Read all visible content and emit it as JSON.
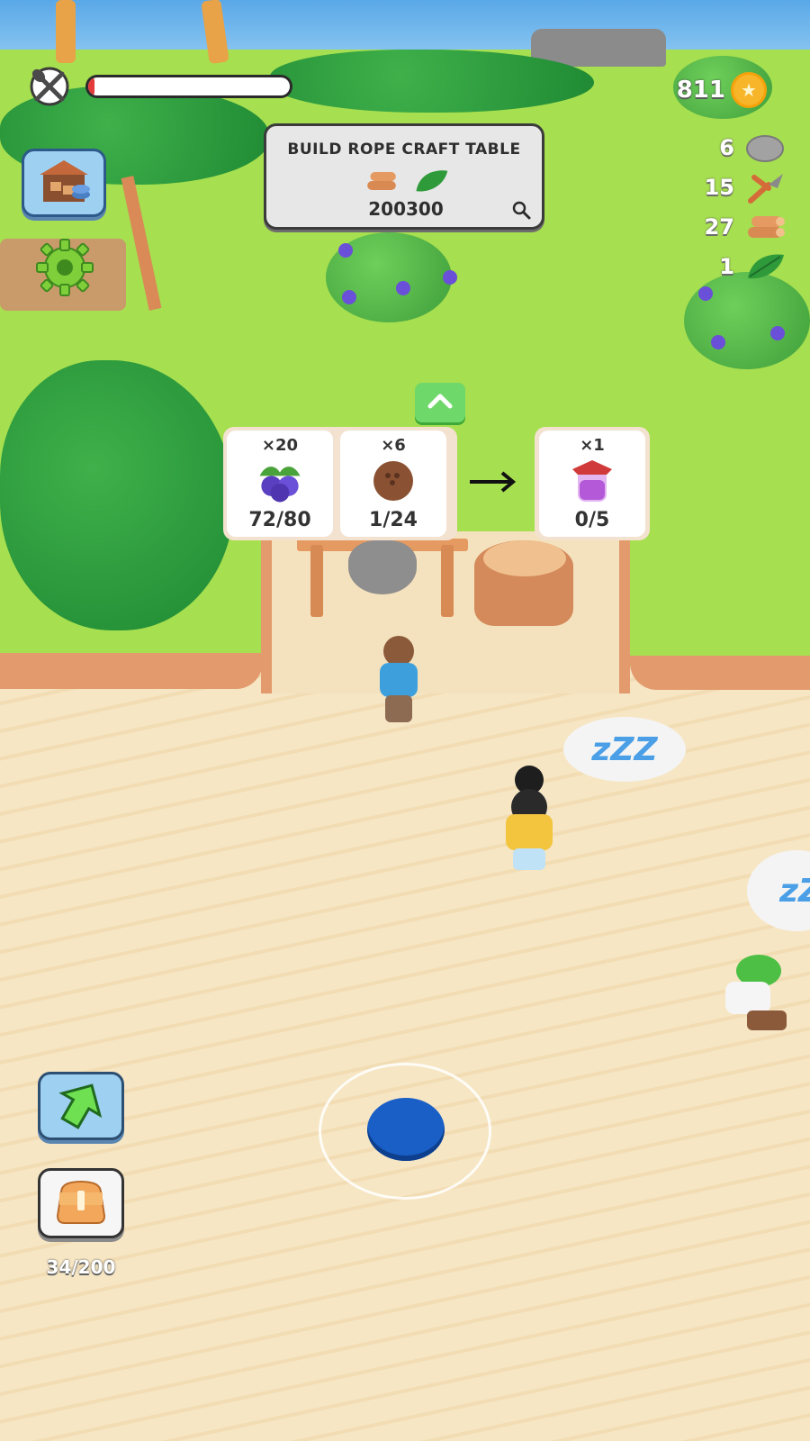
{
  "hud": {
    "hunger_level": 0.03,
    "coins": "811",
    "resources": [
      {
        "value": "6",
        "icon": "stone-icon"
      },
      {
        "value": "15",
        "icon": "pruning-shears-icon"
      },
      {
        "value": "27",
        "icon": "wood-logs-icon"
      },
      {
        "value": "1",
        "icon": "leaf-icon"
      }
    ]
  },
  "quest": {
    "title": "BUILD ROPE CRAFT TABLE",
    "costs": [
      {
        "icon": "wood-logs-icon",
        "value": "200"
      },
      {
        "icon": "leaf-icon",
        "value": "300"
      }
    ]
  },
  "recipe": {
    "inputs": [
      {
        "multiplier": "×20",
        "icon": "blueberry-icon",
        "count": "72/80"
      },
      {
        "multiplier": "×6",
        "icon": "coconut-icon",
        "count": "1/24"
      }
    ],
    "output": {
      "multiplier": "×1",
      "icon": "jam-jar-icon",
      "count": "0/5"
    }
  },
  "sleep_bubbles": [
    "zZZ",
    "zZ"
  ],
  "inventory": {
    "capacity": "34/200"
  },
  "colors": {
    "grass": "#a6df4f",
    "sand": "#f6e6c4",
    "joystick": "#1a5fc6",
    "hunger": "#e53a3a",
    "button_blue": "#9ed0f2"
  }
}
